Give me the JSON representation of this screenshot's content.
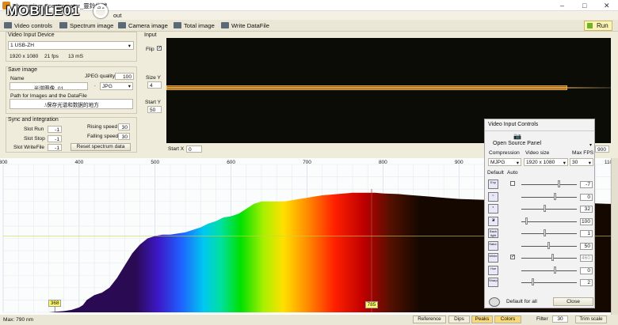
{
  "window": {
    "title": "Theremino_Spectrometer_靈鈴信號",
    "menu_fragment": "out",
    "logo_text": "MOBILE01"
  },
  "toolbar": {
    "items": [
      "Video controls",
      "Spectrum image",
      "Camera image",
      "Total image",
      "Write DataFile"
    ],
    "run": "Run"
  },
  "video_input": {
    "title": "Video Input Device",
    "device": "1 USB-ZH",
    "resolution": "1920 x 1080",
    "fps": "21 fps",
    "exposure": "13 mS"
  },
  "save_image": {
    "title": "Save image",
    "name_label": "Name",
    "jpeg_label": "JPEG quality",
    "jpeg_value": "100",
    "name_value": "光谱图像_01",
    "ext_dot": ".",
    "format": "JPG",
    "path_label": "Path for Images and the DataFile",
    "path_value": ".\\保存光谱和数据的地方"
  },
  "sync": {
    "title": "Sync and integration",
    "slot_run_label": "Slot Run",
    "slot_run": "-1",
    "slot_stop_label": "Slot Stop",
    "slot_stop": "-1",
    "slot_write_label": "Slot WriteFile",
    "slot_write": "-1",
    "rising_label": "Rising speed",
    "rising": "30",
    "falling_label": "Falling speed",
    "falling": "30",
    "reset": "Reset spectrum data"
  },
  "input": {
    "title": "Input",
    "flip": "Flip",
    "flip_check": "✓",
    "size_y_label": "Size Y",
    "size_y": "4",
    "start_y_label": "Start Y",
    "start_y": "50",
    "start_x_label": "Start X",
    "start_x": "0",
    "right_value": "900"
  },
  "popup": {
    "title": "Video Input Controls",
    "open_source": "Open Source Panel",
    "compression_label": "Compression",
    "compression": "MJPG",
    "video_size_label": "Video size",
    "video_size": "1920 x 1080",
    "max_fps_label": "Max FPS",
    "max_fps": "30",
    "default_label": "Default",
    "auto_label": "Auto",
    "check_mark": "✓",
    "default_all": "Default for all",
    "close": "Close",
    "controls": [
      {
        "icon": "Exp",
        "value": "-7",
        "pos": 0.7
      },
      {
        "icon": "☼",
        "value": "0",
        "pos": 0.62
      },
      {
        "icon": "◐",
        "value": "32",
        "pos": 0.42
      },
      {
        "icon": "◪",
        "value": "100",
        "pos": 0.08
      },
      {
        "icon": "Back light",
        "value": "1",
        "pos": 0.42
      },
      {
        "icon": "Satur.",
        "value": "50",
        "pos": 0.5
      },
      {
        "icon": "White",
        "value": "460",
        "pos": 0.58
      },
      {
        "icon": "Hue",
        "value": "0",
        "pos": 0.62
      },
      {
        "icon": "Sharp.",
        "value": "2",
        "pos": 0.2
      }
    ]
  },
  "chart_data": {
    "type": "area",
    "xlim": [
      300,
      1100
    ],
    "ticks": [
      "300",
      "400",
      "500",
      "600",
      "700",
      "800",
      "900",
      "1000",
      "110"
    ],
    "x": [
      300,
      360,
      368,
      380,
      390,
      400,
      405,
      410,
      420,
      430,
      440,
      450,
      460,
      470,
      480,
      490,
      500,
      510,
      520,
      530,
      540,
      550,
      560,
      570,
      580,
      590,
      600,
      610,
      620,
      630,
      640,
      650,
      660,
      670,
      680,
      690,
      700,
      710,
      720,
      730,
      740,
      750,
      760,
      770,
      780,
      790,
      800,
      820,
      840,
      860,
      880,
      900,
      950,
      1000,
      1050,
      1100
    ],
    "y": [
      0,
      0,
      0.5,
      1,
      2,
      4,
      6,
      10,
      14,
      16,
      20,
      28,
      38,
      48,
      55,
      60,
      62,
      63,
      63,
      64,
      65,
      67,
      69,
      72,
      74,
      77,
      78,
      80,
      84,
      88,
      90,
      90,
      90,
      90,
      91,
      92,
      93,
      94,
      95,
      95.5,
      96,
      96.5,
      97,
      97,
      97,
      97,
      96.5,
      96,
      95,
      94,
      93,
      92,
      91,
      90,
      89,
      88
    ],
    "ylim": [
      0,
      120
    ],
    "peak_marker": "785",
    "min_marker": "368"
  },
  "status": {
    "max_text": "Max: 790 nm",
    "reference": "Reference",
    "dips": "Dips",
    "peaks": "Peaks",
    "colors": "Colors",
    "filter_label": "Filter",
    "filter_value": "30",
    "trim": "Trim scale"
  }
}
